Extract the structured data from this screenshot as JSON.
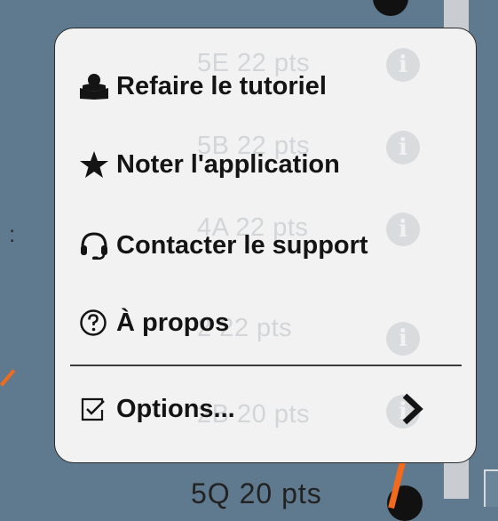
{
  "background": {
    "bottom_text": "5Q  20 pts"
  },
  "menu": {
    "ghost_rows": [
      {
        "text": "5E  22 pts"
      },
      {
        "text": "5B  22 pts"
      },
      {
        "text": "4A  22 pts"
      },
      {
        "text": "2   22 pts"
      },
      {
        "text": "2B  20 pts"
      }
    ],
    "items": [
      {
        "label": "Refaire le tutoriel",
        "icon": "user-reading-icon"
      },
      {
        "label": "Noter l'application",
        "icon": "star-icon"
      },
      {
        "label": "Contacter le support",
        "icon": "headset-icon"
      },
      {
        "label": "À propos",
        "icon": "question-circle-icon"
      }
    ],
    "options": {
      "label": "Options...",
      "icon": "checkbox-icon",
      "chevron": "chevron-right-icon"
    }
  },
  "annotation": {
    "color": "#f26b1d"
  }
}
